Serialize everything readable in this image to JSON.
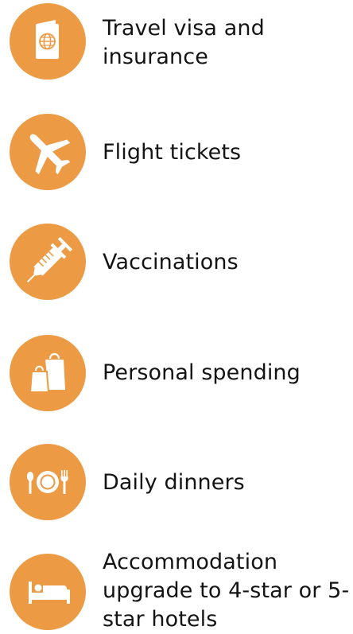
{
  "brand": {
    "accent_color": "#ec9a43",
    "text_color": "#141414"
  },
  "items": [
    {
      "label": "Travel visa and\ninsurance",
      "icon": "passport-icon"
    },
    {
      "label": "Flight tickets",
      "icon": "airplane-icon"
    },
    {
      "label": "Vaccinations",
      "icon": "syringe-icon"
    },
    {
      "label": "Personal spending",
      "icon": "shopping-bags-icon"
    },
    {
      "label": "Daily dinners",
      "icon": "plate-cutlery-icon"
    },
    {
      "label": "Accommodation\nupgrade to 4-star or   5-\nstar hotels",
      "icon": "bed-icon"
    }
  ]
}
